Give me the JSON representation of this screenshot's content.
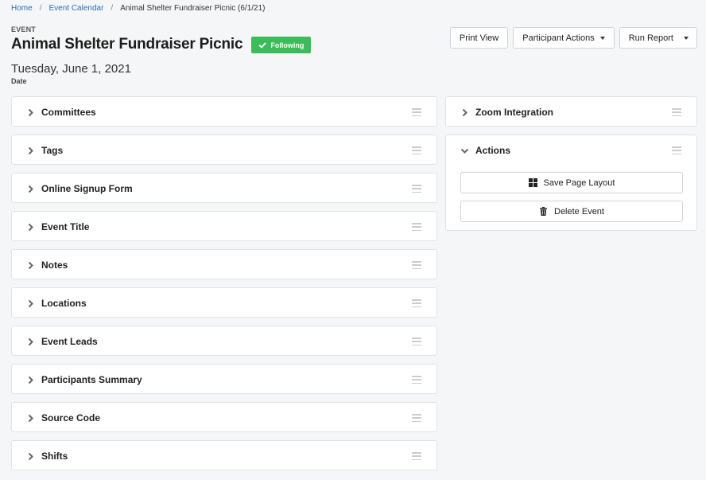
{
  "breadcrumb": {
    "home": "Home",
    "calendar": "Event Calendar",
    "current": "Animal Shelter Fundraiser Picnic (6/1/21)",
    "separator": "/"
  },
  "header": {
    "kicker": "EVENT",
    "title": "Animal Shelter Fundraiser Picnic",
    "following_label": "Following",
    "following_color": "#3dbb5b",
    "date_value": "Tuesday, June 1, 2021",
    "date_label": "Date"
  },
  "toolbar": {
    "print_view": "Print View",
    "participant_actions": "Participant Actions",
    "run_report": "Run Report"
  },
  "left_panels": [
    {
      "title": "Committees"
    },
    {
      "title": "Tags"
    },
    {
      "title": "Online Signup Form"
    },
    {
      "title": "Event Title"
    },
    {
      "title": "Notes"
    },
    {
      "title": "Locations"
    },
    {
      "title": "Event Leads"
    },
    {
      "title": "Participants Summary"
    },
    {
      "title": "Source Code"
    },
    {
      "title": "Shifts"
    }
  ],
  "right_panels": {
    "zoom": {
      "title": "Zoom Integration"
    },
    "actions": {
      "title": "Actions",
      "save_layout": "Save Page Layout",
      "delete_event": "Delete Event"
    }
  },
  "icons": {
    "following": "check-icon",
    "collapsed": "chevron-right-icon",
    "expanded": "chevron-down-icon",
    "drag": "drag-handle-icon",
    "save_layout": "grid-icon",
    "delete_event": "trash-icon"
  }
}
